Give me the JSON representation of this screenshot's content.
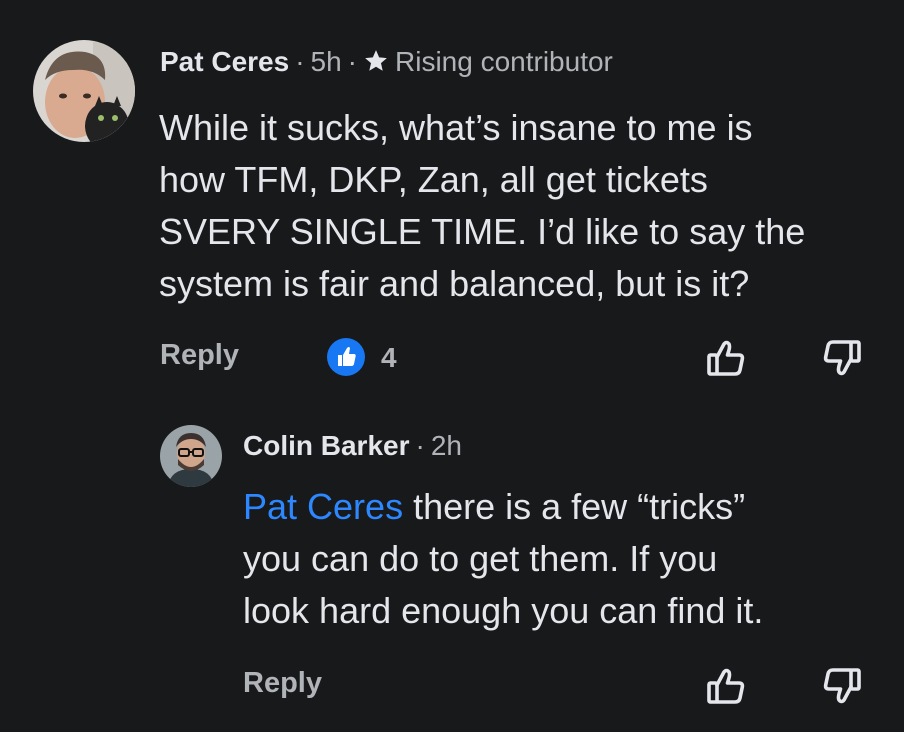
{
  "comment": {
    "author": "Pat Ceres",
    "time": "5h",
    "badge": "Rising contributor",
    "text_lines": [
      "While it sucks, what’s insane to me is",
      "how TFM, DKP, Zan, all get tickets",
      "SVERY SINGLE TIME. I’d like to say the",
      "system is fair and balanced, but is it?"
    ],
    "reply_label": "Reply",
    "like_count": "4"
  },
  "reply": {
    "author": "Colin Barker",
    "time": "2h",
    "mention": "Pat Ceres",
    "text_first_line_rest": " there is a few “tricks”",
    "text_lines": [
      "you can do to get them. If you",
      "look hard enough you can find it."
    ],
    "reply_label": "Reply"
  },
  "separator": "·",
  "icons": {
    "badge": "star-icon",
    "reaction": "like-reaction-icon",
    "upvote": "thumbs-up-outline-icon",
    "downvote": "thumbs-down-outline-icon"
  },
  "colors": {
    "background": "#18191a",
    "text": "#e4e6eb",
    "secondary": "#b0b3b8",
    "mention": "#2d88ff",
    "like_blue": "#1877f2"
  }
}
